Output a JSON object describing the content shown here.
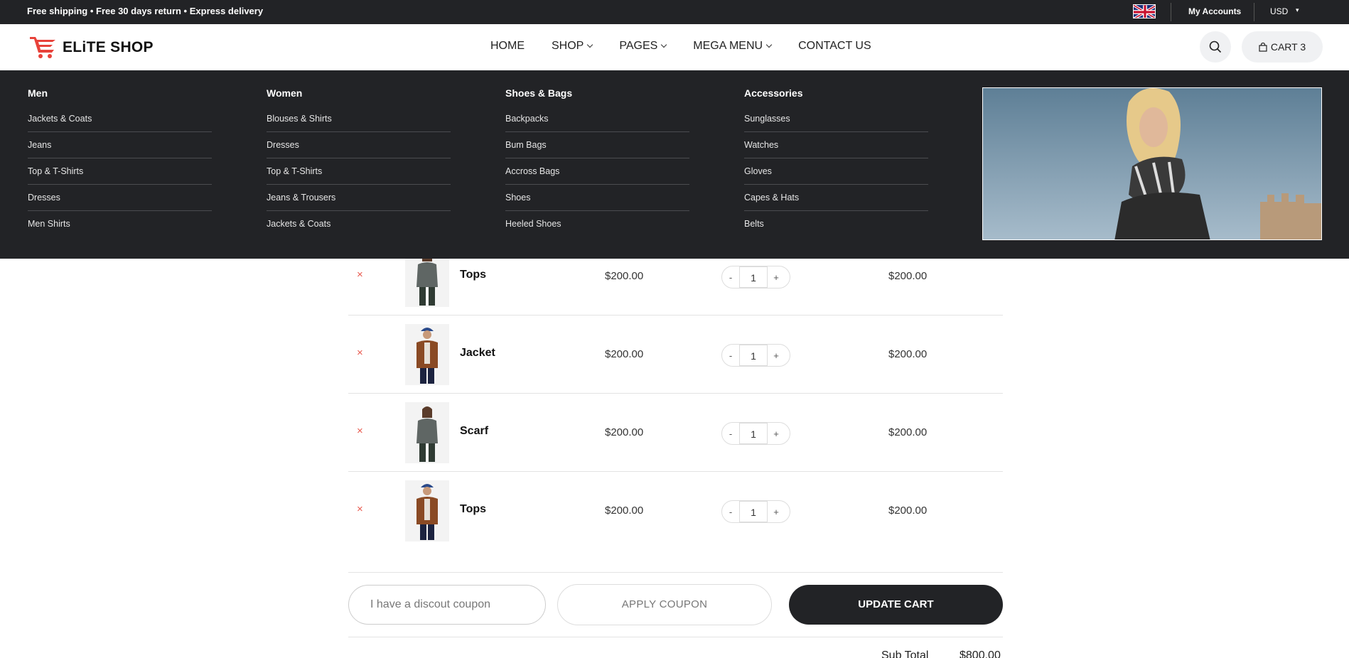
{
  "topbar": {
    "promo": "Free shipping • Free 30 days return • Express delivery",
    "language_flag": "uk-flag-icon",
    "accounts": "My Accounts",
    "currency": "USD"
  },
  "header": {
    "logo_text": "ELiTE SHOP",
    "nav": [
      {
        "label": "HOME",
        "dropdown": false
      },
      {
        "label": "SHOP",
        "dropdown": true
      },
      {
        "label": "PAGES",
        "dropdown": true
      },
      {
        "label": "MEGA MENU",
        "dropdown": true
      },
      {
        "label": "CONTACT US",
        "dropdown": false
      }
    ],
    "cart_label": "CART 3"
  },
  "mega_menu": {
    "columns": [
      {
        "title": "Men",
        "links": [
          "Jackets & Coats",
          "Jeans",
          "Top & T-Shirts",
          "Dresses",
          "Men Shirts"
        ]
      },
      {
        "title": "Women",
        "links": [
          "Blouses & Shirts",
          "Dresses",
          "Top & T-Shirts",
          "Jeans & Trousers",
          "Jackets & Coats"
        ]
      },
      {
        "title": "Shoes & Bags",
        "links": [
          "Backpacks",
          "Bum Bags",
          "Accross Bags",
          "Shoes",
          "Heeled Shoes"
        ]
      },
      {
        "title": "Accessories",
        "links": [
          "Sunglasses",
          "Watches",
          "Gloves",
          "Capes & Hats",
          "Belts"
        ]
      }
    ]
  },
  "cart": {
    "items": [
      {
        "name": "Tops",
        "price": "$200.00",
        "qty": "1",
        "total": "$200.00",
        "image": "woman-grey-top"
      },
      {
        "name": "Jacket",
        "price": "$200.00",
        "qty": "1",
        "total": "$200.00",
        "image": "man-brown-jacket"
      },
      {
        "name": "Scarf",
        "price": "$200.00",
        "qty": "1",
        "total": "$200.00",
        "image": "woman-grey-top"
      },
      {
        "name": "Tops",
        "price": "$200.00",
        "qty": "1",
        "total": "$200.00",
        "image": "man-brown-jacket"
      }
    ],
    "remove_symbol": "×",
    "minus": "-",
    "plus": "+",
    "coupon_placeholder": "I have a discout coupon",
    "apply_label": "APPLY COUPON",
    "update_label": "UPDATE CART",
    "subtotal_label": "Sub Total",
    "subtotal_value": "$800.00"
  },
  "colors": {
    "dark": "#222326",
    "accent": "#e8423a",
    "remove": "#e85a4f"
  }
}
